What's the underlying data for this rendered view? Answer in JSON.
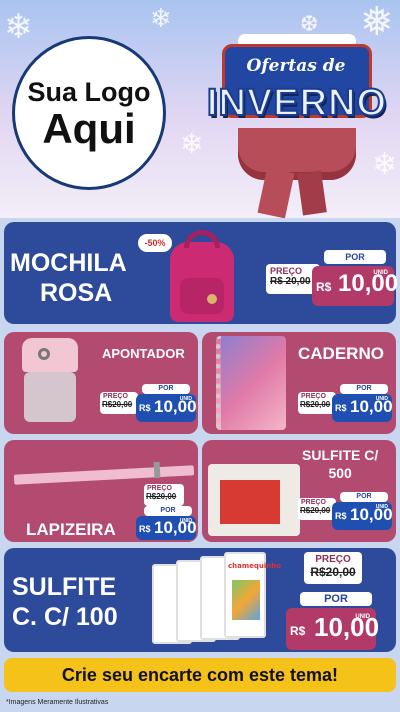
{
  "logo": {
    "line1": "Sua Logo",
    "line2": "Aqui"
  },
  "banner": {
    "line1": "Ofertas de",
    "line2": "INVERNO"
  },
  "products": {
    "mochila": {
      "title_l1": "MOCHILA",
      "title_l2": "ROSA",
      "discount": "-50%",
      "preco_label": "PREÇO",
      "old_price": "R$ 20,00",
      "por_label": "POR",
      "currency": "R$",
      "price": "10,00",
      "unit": "UNID"
    },
    "apontador": {
      "title": "APONTADOR",
      "preco_label": "PREÇO",
      "old_price": "R$20,00",
      "por_label": "POR",
      "currency": "R$",
      "price": "10,00",
      "unit": "UNID"
    },
    "caderno": {
      "title": "CADERNO",
      "preco_label": "PREÇO",
      "old_price": "R$20,00",
      "por_label": "POR",
      "currency": "R$",
      "price": "10,00",
      "unit": "UNID"
    },
    "lapizeira": {
      "title": "LAPIZEIRA",
      "preco_label": "PREÇO",
      "old_price": "R$20,00",
      "por_label": "POR",
      "currency": "R$",
      "price": "10,00",
      "unit": "UNID"
    },
    "sulfite500": {
      "title_l1": "SULFITE C/",
      "title_l2": "500",
      "preco_label": "PREÇO",
      "old_price": "R$20,00",
      "por_label": "POR",
      "currency": "R$",
      "price": "10,00",
      "unit": "UNID"
    },
    "sulfite100": {
      "title_l1": "SULFITE",
      "title_l2": "C. C/ 100",
      "preco_label": "PREÇO",
      "old_price": "R$20,00",
      "por_label": "POR",
      "currency": "R$",
      "price": "10,00",
      "unit": "UNID",
      "brand": "chamequinho"
    }
  },
  "footer": {
    "cta": "Crie seu encarte com este tema!",
    "disclaimer": "*Imagens Meramente Ilustrativas"
  },
  "colors": {
    "blue": "#2e4a9a",
    "pink": "#b34a6f",
    "yellow": "#f5c21a"
  }
}
